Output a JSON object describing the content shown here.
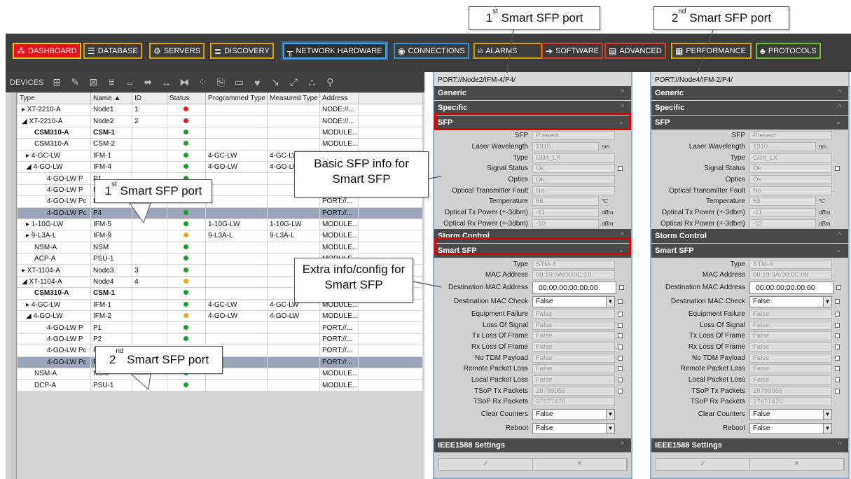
{
  "callouts": {
    "port1_top": "Smart SFP port",
    "port1_top_sup": "st",
    "port1_top_num": "1",
    "port2_top": "Smart SFP port",
    "port2_top_sup": "nd",
    "port2_top_num": "2",
    "basic_info": "Basic SFP info for Smart SFP",
    "extra_info": "Extra info/config for Smart SFP",
    "port1_grid": "Smart SFP port",
    "port1_grid_num": "1",
    "port1_grid_sup": "st",
    "port2_grid": "Smart SFP port",
    "port2_grid_num": "2",
    "port2_grid_sup": "nd"
  },
  "nav": {
    "dashboard": "DASHBOARD",
    "database": "DATABASE",
    "servers": "SERVERS",
    "discovery": "DISCOVERY",
    "network_hardware": "NETWORK HARDWARE",
    "connections": "CONNECTIONS",
    "alarms": "ALARMS",
    "software": "SOFTWARE",
    "advanced": "ADVANCED",
    "performance": "PERFORMANCE",
    "protocols": "PROTOCOLS"
  },
  "devices": {
    "label": "DEVICES",
    "headers": [
      "Type",
      "Name ▲",
      "ID",
      "Status",
      "Programmed Type",
      "Measured Type",
      "Address"
    ],
    "rows": [
      {
        "type": "▸ XT-2210-A",
        "name": "Node1",
        "id": "1",
        "status": "red",
        "prog": "",
        "meas": "",
        "addr": "NODE://..."
      },
      {
        "type": "◢ XT-2210-A",
        "name": "Node2",
        "id": "2",
        "status": "red",
        "prog": "",
        "meas": "",
        "addr": "NODE://..."
      },
      {
        "type": "CSM310-A",
        "name": "CSM-1",
        "id": "",
        "status": "green",
        "prog": "",
        "meas": "",
        "addr": "MODULE...",
        "bold": true
      },
      {
        "type": "CSM310-A",
        "name": "CSM-2",
        "id": "",
        "status": "green",
        "prog": "",
        "meas": "",
        "addr": "MODULE..."
      },
      {
        "type": "▸ 4-GC-LW",
        "name": "IFM-1",
        "id": "",
        "status": "green",
        "prog": "4-GC-LW",
        "meas": "4-GC-LW",
        "addr": "MODULE..."
      },
      {
        "type": "◢ 4-GO-LW",
        "name": "IFM-4",
        "id": "",
        "status": "green",
        "prog": "4-GO-LW",
        "meas": "4-GO-LW",
        "addr": "MODULE..."
      },
      {
        "type": "4-GO-LW P",
        "name": "P1",
        "id": "",
        "status": "green",
        "prog": "",
        "meas": "",
        "addr": "PORT://..."
      },
      {
        "type": "4-GO-LW P",
        "name": "P2",
        "id": "",
        "status": "green",
        "prog": "",
        "meas": "",
        "addr": "PORT://..."
      },
      {
        "type": "4-GO-LW Pc",
        "name": "P3",
        "id": "",
        "status": "green",
        "prog": "",
        "meas": "",
        "addr": "PORT://..."
      },
      {
        "type": "4-GO-LW Pc",
        "name": "P4",
        "id": "",
        "status": "green",
        "prog": "",
        "meas": "",
        "addr": "PORT://...",
        "sel": true
      },
      {
        "type": "▸ 1-10G-LW",
        "name": "IFM-5",
        "id": "",
        "status": "green",
        "prog": "1-10G-LW",
        "meas": "1-10G-LW",
        "addr": "MODULE..."
      },
      {
        "type": "▸ 9-L3A-L",
        "name": "IFM-9",
        "id": "",
        "status": "orange",
        "prog": "9-L3A-L",
        "meas": "9-L3A-L",
        "addr": "MODULE..."
      },
      {
        "type": "NSM-A",
        "name": "NSM",
        "id": "",
        "status": "green",
        "prog": "",
        "meas": "",
        "addr": "MODULE..."
      },
      {
        "type": "ACP-A",
        "name": "PSU-1",
        "id": "",
        "status": "green",
        "prog": "",
        "meas": "",
        "addr": "MODULE..."
      },
      {
        "type": "▸ XT-1104-A",
        "name": "Node3",
        "id": "3",
        "status": "green",
        "prog": "",
        "meas": "",
        "addr": "NODE://..."
      },
      {
        "type": "◢ XT-1104-A",
        "name": "Node4",
        "id": "4",
        "status": "orange",
        "prog": "",
        "meas": "",
        "addr": "NODE://..."
      },
      {
        "type": "CSM310-A",
        "name": "CSM-1",
        "id": "",
        "status": "green",
        "prog": "",
        "meas": "",
        "addr": "MODULE...",
        "bold": true
      },
      {
        "type": "▸ 4-GC-LW",
        "name": "IFM-1",
        "id": "",
        "status": "green",
        "prog": "4-GC-LW",
        "meas": "4-GC-LW",
        "addr": "MODULE..."
      },
      {
        "type": "◢ 4-GO-LW",
        "name": "IFM-2",
        "id": "",
        "status": "orange",
        "prog": "4-GO-LW",
        "meas": "4-GO-LW",
        "addr": "MODULE..."
      },
      {
        "type": "4-GO-LW P",
        "name": "P1",
        "id": "",
        "status": "green",
        "prog": "",
        "meas": "",
        "addr": "PORT://..."
      },
      {
        "type": "4-GO-LW P",
        "name": "P2",
        "id": "",
        "status": "green",
        "prog": "",
        "meas": "",
        "addr": "PORT://..."
      },
      {
        "type": "4-GO-LW Pc",
        "name": "P3",
        "id": "",
        "status": "green",
        "prog": "",
        "meas": "",
        "addr": "PORT://..."
      },
      {
        "type": "4-GO-LW Pc",
        "name": "P4",
        "id": "",
        "status": "green",
        "prog": "",
        "meas": "",
        "addr": "PORT://...",
        "sel": true
      },
      {
        "type": "NSM-A",
        "name": "NSM",
        "id": "",
        "status": "green",
        "prog": "",
        "meas": "",
        "addr": "MODULE..."
      },
      {
        "type": "DCP-A",
        "name": "PSU-1",
        "id": "",
        "status": "green",
        "prog": "",
        "meas": "",
        "addr": "MODULE..."
      }
    ]
  },
  "panes": [
    {
      "path": "PORT://Node2/IFM-4/P4/",
      "temp": "56",
      "tx": "-11",
      "rx": "-10",
      "mac": "00:19:3A:00:0C:18",
      "tsop_tx": "28799955",
      "tsop_rx": "27677470"
    },
    {
      "path": "PORT://Node4/IFM-2/P4/",
      "temp": "53",
      "tx": "-11",
      "rx": "-12",
      "mac": "00:19:3A:00:0C:08",
      "tsop_tx": "28799955",
      "tsop_rx": "27677470"
    }
  ],
  "sections": {
    "generic": "Generic",
    "specific": "Specific",
    "sfp": "SFP",
    "storm": "Storm Control",
    "smart": "Smart SFP",
    "ieee": "IEEE1588 Settings"
  },
  "fields": {
    "sfp": "SFP",
    "sfp_v": "Present",
    "wave": "Laser Wavelength",
    "wave_v": "1310",
    "wave_u": "nm",
    "type": "Type",
    "type_v": "GBit_LX",
    "sig": "Signal Status",
    "sig_v": "Ok",
    "opt": "Optics",
    "opt_v": "Ok",
    "otf": "Optical Transmitter Fault",
    "otf_v": "No",
    "temp": "Temperature",
    "temp_u": "°C",
    "tx": "Optical Tx Power (+-3dbm)",
    "rx": "Optical Rx Power (+-3dbm)",
    "pw_u": "dBm",
    "s_type": "Type",
    "s_type_v": "STM-4",
    "mac": "MAC Address",
    "dmac": "Destination MAC Address",
    "dmac_v": "00:00:00:00:00:00",
    "dmc": "Destination MAC Check",
    "false": "False",
    "ef": "Equipment Failure",
    "los": "Loss Of Signal",
    "txl": "Tx Loss Of Frame",
    "rxl": "Rx Loss Of Frame",
    "ntdm": "No TDM Payload",
    "rpl": "Remote Packet Loss",
    "lpl": "Local Packet Loss",
    "tstx": "TSoP Tx Packets",
    "tsrx": "TSoP Rx Packets",
    "cc": "Clear Counters",
    "reboot": "Reboot",
    "ok": "✓",
    "cancel": "✕"
  }
}
